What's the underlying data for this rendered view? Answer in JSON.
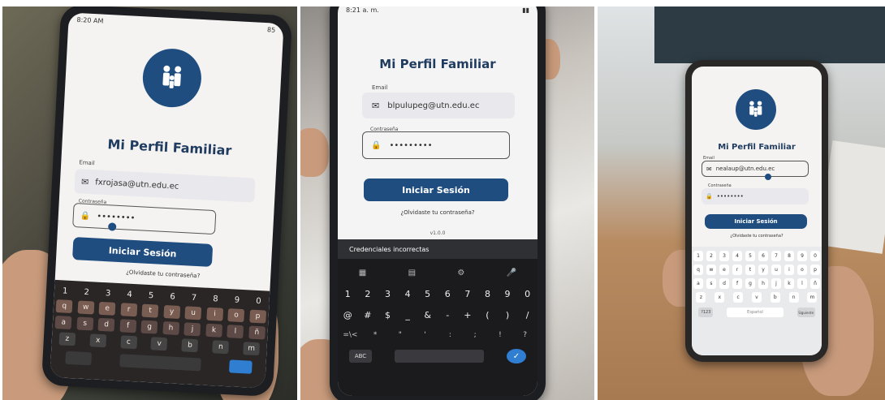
{
  "photos": [
    {
      "status_time": "8:20 AM",
      "status_right": "85",
      "app_title": "Mi Perfil Familiar",
      "email_label": "Email",
      "email_value": "fxrojasa@utn.edu.ec",
      "password_label": "Contraseña",
      "password_value": "••••••••",
      "login_button": "Iniciar Sesión",
      "forgot_link": "¿Olvidaste tu contraseña?",
      "keyboard_numbers": [
        "1",
        "2",
        "3",
        "4",
        "5",
        "6",
        "7",
        "8",
        "9",
        "0"
      ],
      "keyboard_row1": [
        "q",
        "w",
        "e",
        "r",
        "t",
        "y",
        "u",
        "i",
        "o",
        "p"
      ],
      "keyboard_row2": [
        "a",
        "s",
        "d",
        "f",
        "g",
        "h",
        "j",
        "k",
        "l",
        "ñ"
      ],
      "keyboard_row3": [
        "z",
        "x",
        "c",
        "v",
        "b",
        "n",
        "m"
      ]
    },
    {
      "status_time": "8:21 a. m.",
      "app_title": "Mi Perfil Familiar",
      "email_label": "Email",
      "email_value": "blpulupeg@utn.edu.ec",
      "password_label": "Contraseña",
      "password_value": "•••••••••",
      "login_button": "Iniciar Sesión",
      "forgot_link": "¿Olvidaste tu contraseña?",
      "version": "v1.0.0",
      "snackbar": "Credenciales incorrectas",
      "keyboard_numbers": [
        "1",
        "2",
        "3",
        "4",
        "5",
        "6",
        "7",
        "8",
        "9",
        "0"
      ],
      "keyboard_symbols1": [
        "@",
        "#",
        "$",
        "_",
        "&",
        "-",
        "+",
        "(",
        ")",
        "/"
      ],
      "keyboard_symbols2": [
        "=\\<",
        "*",
        "\"",
        "'",
        ":",
        ";",
        "!",
        "?"
      ],
      "keyboard_abc": "ABC"
    },
    {
      "app_title": "Mi Perfil Familiar",
      "email_label": "Email",
      "email_value": "nealaup@utn.edu.ec",
      "password_label": "Contraseña",
      "password_value": "••••••••",
      "login_button": "Iniciar Sesión",
      "forgot_link": "¿Olvidaste tu contraseña?",
      "keyboard_numbers": [
        "1",
        "2",
        "3",
        "4",
        "5",
        "6",
        "7",
        "8",
        "9",
        "0"
      ],
      "keyboard_row1": [
        "q",
        "w",
        "e",
        "r",
        "t",
        "y",
        "u",
        "i",
        "o",
        "p"
      ],
      "keyboard_row2": [
        "a",
        "s",
        "d",
        "f",
        "g",
        "h",
        "j",
        "k",
        "l",
        "ñ"
      ],
      "keyboard_row3": [
        "z",
        "x",
        "c",
        "v",
        "b",
        "n",
        "m"
      ],
      "keyboard_space": "Español",
      "keyboard_action": "Siguiente"
    }
  ],
  "colors": {
    "brand": "#1f4d80",
    "screen_bg": "#f4f3f1",
    "keyboard_dark": "#1b1b1e"
  }
}
